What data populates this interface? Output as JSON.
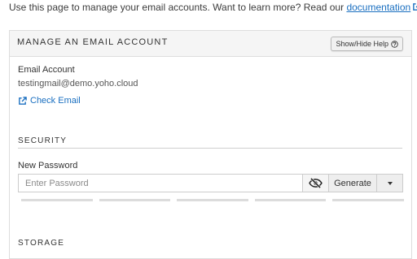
{
  "intro": {
    "text": "Use this page to manage your email accounts. Want to learn more? Read our",
    "link_label": "documentation",
    "suffix": "."
  },
  "panel": {
    "title": "MANAGE AN EMAIL ACCOUNT",
    "help_button": "Show/Hide Help",
    "help_icon": "question-circle-icon"
  },
  "account": {
    "label": "Email Account",
    "email": "testingmail@demo.yoho.cloud",
    "check_email_label": "Check Email",
    "check_email_icon": "external-link-icon"
  },
  "security": {
    "title": "SECURITY",
    "password_label": "New Password",
    "password_placeholder": "Enter Password",
    "toggle_icon": "eye-slash-icon",
    "generate_label": "Generate",
    "strength_segments": 5
  },
  "storage": {
    "title": "STORAGE"
  },
  "colors": {
    "link": "#1a6fc0",
    "header_bg": "#f5f5f5",
    "border": "#dddddd"
  }
}
